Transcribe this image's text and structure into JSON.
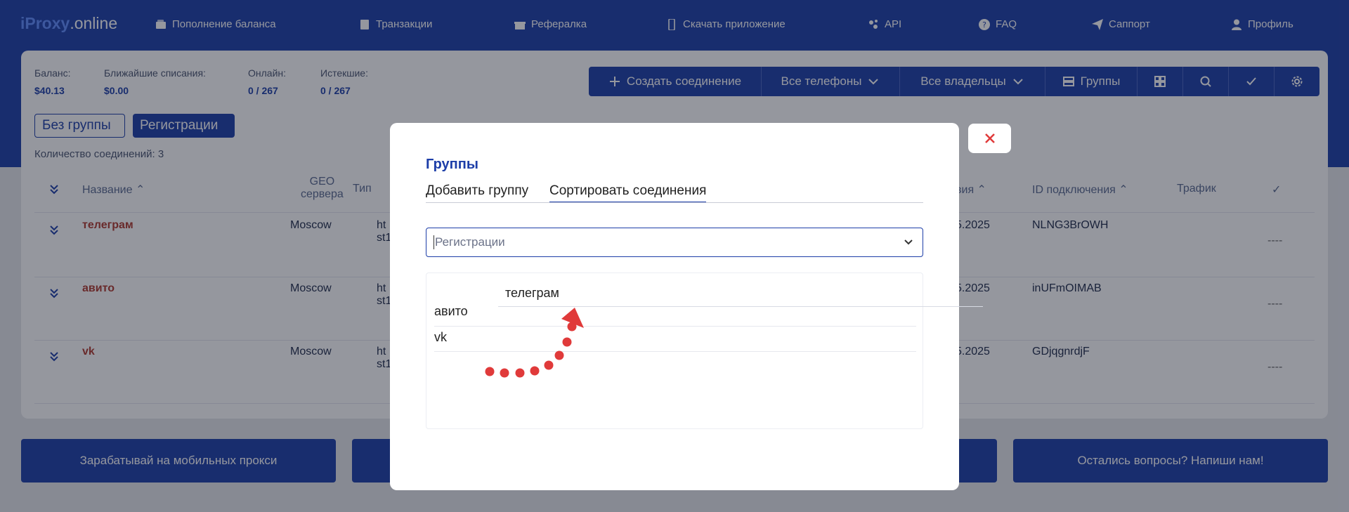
{
  "nav": {
    "logo_part1": "iProxy",
    "logo_part2": ".online",
    "items": [
      {
        "label": "Пополнение баланса",
        "icon": "wallet-icon"
      },
      {
        "label": "Транзакции",
        "icon": "document-icon"
      },
      {
        "label": "Рефералка",
        "icon": "gift-icon"
      },
      {
        "label": "Скачать приложение",
        "icon": "phone-icon"
      },
      {
        "label": "API",
        "icon": "api-icon"
      },
      {
        "label": "FAQ",
        "icon": "question-icon"
      },
      {
        "label": "Саппорт",
        "icon": "send-icon"
      },
      {
        "label": "Профиль",
        "icon": "user-icon"
      }
    ]
  },
  "stats": [
    {
      "label": "Баланс:",
      "value": "$40.13"
    },
    {
      "label": "Ближайшие списания:",
      "value": "$0.00"
    },
    {
      "label": "Онлайн:",
      "value": "0 / 267"
    },
    {
      "label": "Истекшие:",
      "value": "0 / 267"
    }
  ],
  "toolbar": {
    "create": "Создать соединение",
    "phones": "Все телефоны",
    "owners": "Все владельцы",
    "groups": "Группы"
  },
  "groups": {
    "no_group": "Без группы",
    "registrations": "Регистрации",
    "count": "Количество соединений: 3"
  },
  "table": {
    "headers": {
      "name": "Название",
      "geo1": "GEO",
      "geo2": "сервера",
      "type": "Тип",
      "date": "вия",
      "conn_id": "ID подключения",
      "traffic": "Трафик"
    },
    "rows": [
      {
        "name": "телеграм",
        "geo": "Moscow",
        "type1": "ht",
        "type2": "st1",
        "date": "5.2025",
        "id": "NLNG3BrOWH",
        "dash": "----"
      },
      {
        "name": "авито",
        "geo": "Moscow",
        "type1": "ht",
        "type2": "st1",
        "date": "5.2025",
        "id": "inUFmOIMAB",
        "dash": "----"
      },
      {
        "name": "vk",
        "geo": "Moscow",
        "type1": "ht",
        "type2": "st1",
        "date": "5.2025",
        "id": "GDjqgnrdjF",
        "dash": "----"
      }
    ]
  },
  "bottom": {
    "earn": "Зарабатывай на мобильных прокси",
    "questions": "Остались вопросы? Напиши нам!"
  },
  "modal": {
    "title": "Группы",
    "tab_add": "Добавить группу",
    "tab_sort": "Сортировать соединения",
    "select_value": "Регистрации",
    "list": [
      "телеграм",
      "авито",
      "vk"
    ]
  },
  "colors": {
    "brand": "#1d3ea8",
    "accent_red": "#e03a3a"
  }
}
